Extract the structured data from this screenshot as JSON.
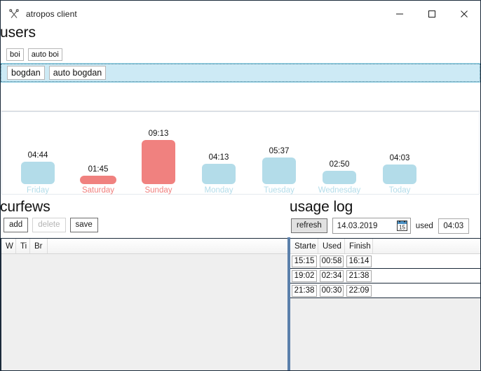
{
  "window": {
    "title": "atropos client",
    "icon": "scissors-icon",
    "controls": {
      "minimize": "minimize-icon",
      "maximize": "maximize-icon",
      "close": "close-icon"
    }
  },
  "sections": {
    "users_heading": "users",
    "curfews_heading": "curfews",
    "usage_heading": "usage log"
  },
  "users": {
    "rows": [
      {
        "name": "boi",
        "auto": "auto boi",
        "selected": false
      },
      {
        "name": "bogdan",
        "auto": "auto bogdan",
        "selected": true
      }
    ]
  },
  "chart_data": {
    "type": "bar",
    "title": "",
    "xlabel": "",
    "ylabel": "",
    "categories": [
      "Friday",
      "Saturday",
      "Sunday",
      "Monday",
      "Tuesday",
      "Wednesday",
      "Today"
    ],
    "labels": [
      "04:44",
      "01:45",
      "09:13",
      "04:13",
      "05:37",
      "02:50",
      "04:03"
    ],
    "values": [
      4.733,
      1.75,
      9.217,
      4.217,
      5.617,
      2.833,
      4.05
    ],
    "ylim": [
      0,
      9.217
    ],
    "grid": false,
    "legend": null,
    "bar_colors": [
      "#b3dce9",
      "#f0817f",
      "#f0817f",
      "#b3dce9",
      "#b3dce9",
      "#b3dce9",
      "#b3dce9"
    ],
    "label_colors": [
      "#b3dce9",
      "#f0817f",
      "#f0817f",
      "#b3dce9",
      "#b3dce9",
      "#b3dce9",
      "#b3dce9"
    ],
    "value_color": "#111111"
  },
  "curfews": {
    "toolbar": {
      "add": "add",
      "delete": "delete",
      "delete_disabled": true,
      "save": "save"
    },
    "columns": [
      "W",
      "Ti",
      "Br"
    ],
    "rows": []
  },
  "usage": {
    "toolbar": {
      "refresh": "refresh",
      "date": "14.03.2019",
      "calendar_icon": "calendar-icon",
      "calendar_day": "15",
      "used_label": "used",
      "used_value": "04:03"
    },
    "columns": [
      "Starte",
      "Used",
      "Finish"
    ],
    "rows": [
      [
        "15:15",
        "00:58",
        "16:14"
      ],
      [
        "19:02",
        "02:34",
        "21:38"
      ],
      [
        "21:38",
        "00:30",
        "22:09"
      ]
    ]
  },
  "colors": {
    "accent_blue": "#b3dce9",
    "accent_red": "#f0817f",
    "selection": "#cdeaf5",
    "splitter": "#5b80ab",
    "frame": "#1b2a3a"
  }
}
